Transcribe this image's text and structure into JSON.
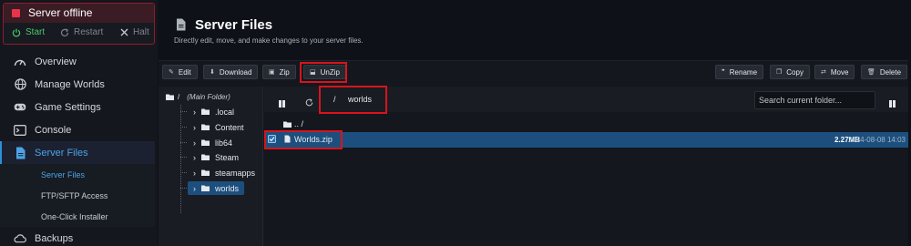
{
  "server": {
    "status": "Server offline",
    "controls": {
      "start": "Start",
      "restart": "Restart",
      "halt": "Halt"
    }
  },
  "colors": {
    "accent": "#2d8fd8",
    "offline": "#e8344a",
    "start": "#4cc76a",
    "selected_row": "#1d4f7e",
    "highlight_box": "#d8141c"
  },
  "nav": {
    "items": [
      {
        "label": "Overview",
        "icon": "gauge-icon"
      },
      {
        "label": "Manage Worlds",
        "icon": "globe-icon"
      },
      {
        "label": "Game Settings",
        "icon": "gamepad-icon"
      },
      {
        "label": "Console",
        "icon": "terminal-icon"
      },
      {
        "label": "Server Files",
        "icon": "file-icon",
        "active": true
      },
      {
        "label": "Backups",
        "icon": "cloud-icon"
      }
    ],
    "sub_items": [
      {
        "label": "Server Files",
        "active": true
      },
      {
        "label": "FTP/SFTP Access"
      },
      {
        "label": "One-Click Installer"
      }
    ]
  },
  "page": {
    "title": "Server Files",
    "subtitle": "Directly edit, move, and make changes to your server files."
  },
  "toolbar": {
    "left": [
      {
        "label": "Edit",
        "icon": "edit-icon"
      },
      {
        "label": "Download",
        "icon": "download-icon"
      },
      {
        "label": "Zip",
        "icon": "zip-icon"
      },
      {
        "label": "UnZip",
        "icon": "unzip-icon"
      }
    ],
    "right": [
      {
        "label": "Rename",
        "icon": "rename-icon"
      },
      {
        "label": "Copy",
        "icon": "copy-icon"
      },
      {
        "label": "Move",
        "icon": "move-icon"
      },
      {
        "label": "Delete",
        "icon": "trash-icon"
      }
    ]
  },
  "tree": {
    "root": "/",
    "root_label": "(Main Folder)",
    "folders": [
      ".local",
      "Content",
      "lib64",
      "Steam",
      "steamapps",
      "worlds"
    ],
    "active": "worlds"
  },
  "browser": {
    "path_separator": "/",
    "current_folder": "worlds",
    "search_placeholder": "Search current folder...",
    "parent": ".. /",
    "files": [
      {
        "name": "Worlds.zip",
        "size": "2.27MB",
        "modified": "2024-08-08 14:03",
        "selected": true
      }
    ]
  }
}
